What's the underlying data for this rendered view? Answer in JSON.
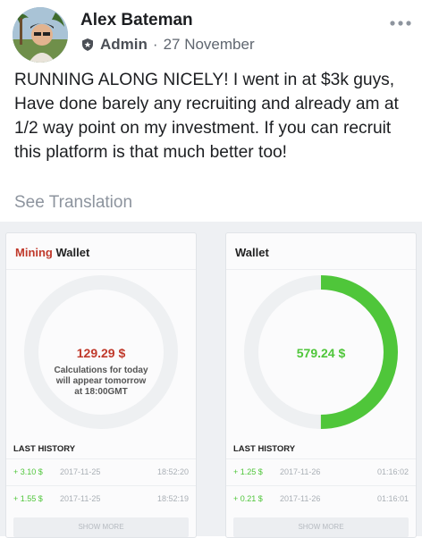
{
  "post": {
    "author": "Alex Bateman",
    "role": "Admin",
    "separator": "·",
    "date": "27 November",
    "more_icon": "more-horizontal-icon",
    "badge_icon": "admin-shield-icon",
    "text": "RUNNING ALONG NICELY! I went in at $3k guys, Have done barely any recruiting and already am at 1/2 way point on my investment. If you can recruit this platform is that much better too!",
    "see_translation": "See Translation"
  },
  "mining_wallet": {
    "title_accent": "Mining",
    "title_rest": "Wallet",
    "amount": "129.29 $",
    "note_line1": "Calculations for today",
    "note_line2": "will appear tomorrow",
    "note_line3": "at 18:00GMT",
    "ring_fill": 0,
    "accent_color": "#c0392b",
    "history_title": "LAST HISTORY",
    "history": [
      {
        "amount": "+ 3.10 $",
        "date": "2017-11-25",
        "time": "18:52:20"
      },
      {
        "amount": "+ 1.55 $",
        "date": "2017-11-25",
        "time": "18:52:19"
      }
    ],
    "show_more": "SHOW MORE"
  },
  "wallet": {
    "title": "Wallet",
    "amount": "579.24 $",
    "ring_fill": 0.5,
    "accent_color": "#4fc63a",
    "history_title": "LAST HISTORY",
    "history": [
      {
        "amount": "+ 1.25 $",
        "date": "2017-11-26",
        "time": "01:16:02"
      },
      {
        "amount": "+ 0.21 $",
        "date": "2017-11-26",
        "time": "01:16:01"
      }
    ],
    "show_more": "SHOW MORE"
  }
}
